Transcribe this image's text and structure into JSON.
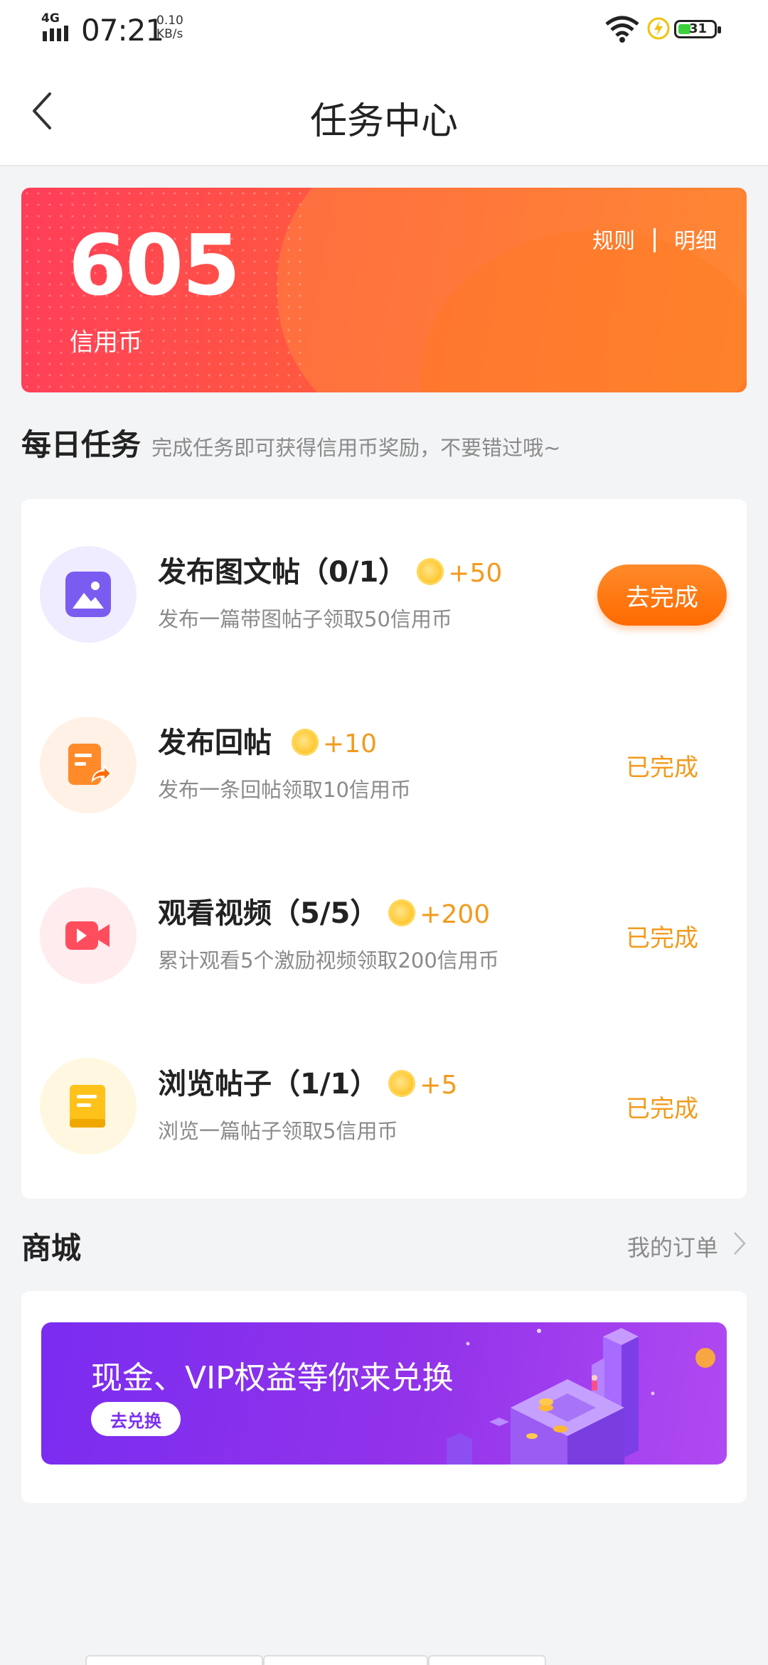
{
  "status_bar": {
    "network": "4G",
    "time": "07:21",
    "speed_value": "0.10",
    "speed_unit": "KB/s",
    "battery": "31"
  },
  "nav": {
    "title": "任务中心",
    "back_icon": "chevron-left-icon"
  },
  "credit": {
    "amount": "605",
    "unit": "信用币",
    "rules_link": "规则",
    "detail_link": "明细"
  },
  "daily": {
    "title": "每日任务",
    "subtitle": "完成任务即可获得信用币奖励，不要错过哦~",
    "tasks": [
      {
        "icon": "image-icon",
        "title": "发布图文帖（0/1）",
        "reward": "+50",
        "desc": "发布一篇带图帖子领取50信用币",
        "action": "去完成",
        "color": "#7b5cf0",
        "bg": "#f0ecff"
      },
      {
        "icon": "reply-post-icon",
        "title": "发布回帖",
        "reward": "+10",
        "desc": "发布一条回帖领取10信用币",
        "action": "已完成",
        "color": "#ff8a2a",
        "bg": "#fff1e6"
      },
      {
        "icon": "video-icon",
        "title": "观看视频（5/5）",
        "reward": "+200",
        "desc": "累计观看5个激励视频领取200信用币",
        "action": "已完成",
        "color": "#ff4d5e",
        "bg": "#ffecee"
      },
      {
        "icon": "document-icon",
        "title": "浏览帖子（1/1）",
        "reward": "+5",
        "desc": "浏览一篇帖子领取5信用币",
        "action": "已完成",
        "color": "#ffc21a",
        "bg": "#fff7df"
      }
    ]
  },
  "mall": {
    "title": "商城",
    "orders_link": "我的订单",
    "banner_text": "现金、VIP权益等你来兑换",
    "banner_button": "去兑换"
  },
  "colors": {
    "accent_orange": "#ff6a00",
    "reward_text": "#f39a1c",
    "banner_red": "#ff3d5a",
    "promo_purple": "#8a30ee"
  }
}
